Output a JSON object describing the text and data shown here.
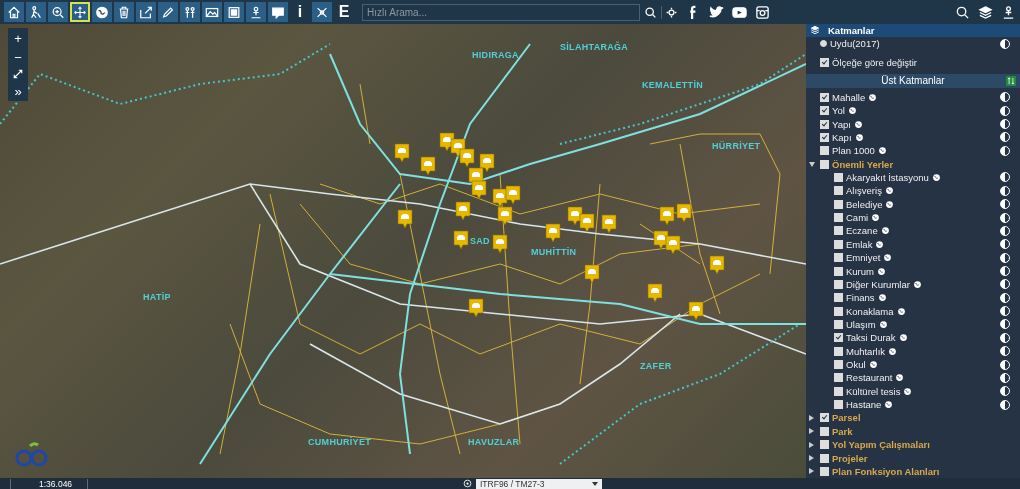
{
  "toolbar": {
    "tools": [
      {
        "kind": "icon",
        "selected": false
      },
      {
        "kind": "icon",
        "selected": false
      },
      {
        "kind": "icon",
        "selected": false
      },
      {
        "kind": "icon",
        "selected": true
      },
      {
        "kind": "icon",
        "selected": false
      },
      {
        "kind": "icon",
        "selected": false
      },
      {
        "kind": "icon",
        "selected": false
      },
      {
        "kind": "icon",
        "selected": false
      },
      {
        "kind": "icon",
        "selected": false
      },
      {
        "kind": "icon",
        "selected": false
      },
      {
        "kind": "icon",
        "selected": false
      },
      {
        "kind": "icon",
        "selected": false
      },
      {
        "kind": "icon",
        "selected": false
      },
      {
        "kind": "text",
        "label": "i",
        "selected": false
      },
      {
        "kind": "icon",
        "selected": false
      },
      {
        "kind": "text",
        "label": "E",
        "selected": false
      }
    ],
    "search": {
      "placeholder": "Hızlı Arama..."
    }
  },
  "map_controls": {
    "zoom_in": "+",
    "zoom_out": "−",
    "more": "»"
  },
  "map_labels": [
    {
      "text": "HIDIRAGA"
    },
    {
      "text": "SİLAHTARAĞA"
    },
    {
      "text": "KEMALETTİN"
    },
    {
      "text": "HÜRRİYET"
    },
    {
      "text": "MUHİTTİN"
    },
    {
      "text": "SAD"
    },
    {
      "text": "HATİP"
    },
    {
      "text": "ZAFER"
    },
    {
      "text": "CUMHURİYET"
    },
    {
      "text": "HAVUZLAR"
    }
  ],
  "layer_panel": {
    "title": "Katmanlar",
    "basemap": {
      "label": "Uydu(2017)",
      "selected": true
    },
    "scale_toggle": {
      "label": "Ölçeğe göre değiştir",
      "checked": true
    },
    "section": "Üst Katmanlar",
    "layers": [
      {
        "kind": "layer",
        "label": "Mahalle",
        "checked": true
      },
      {
        "kind": "layer",
        "label": "Yol",
        "checked": true
      },
      {
        "kind": "layer",
        "label": "Yapı",
        "checked": true
      },
      {
        "kind": "layer",
        "label": "Kapı",
        "checked": true
      },
      {
        "kind": "layer",
        "label": "Plan 1000",
        "checked": false
      },
      {
        "kind": "group",
        "label": "Önemli Yerler",
        "checked": false,
        "expanded": true,
        "children": [
          {
            "label": "Akaryakıt İstasyonu",
            "checked": false
          },
          {
            "label": "Alışveriş",
            "checked": false
          },
          {
            "label": "Belediye",
            "checked": false
          },
          {
            "label": "Cami",
            "checked": false
          },
          {
            "label": "Eczane",
            "checked": false
          },
          {
            "label": "Emlak",
            "checked": false
          },
          {
            "label": "Emniyet",
            "checked": false
          },
          {
            "label": "Kurum",
            "checked": false
          },
          {
            "label": "Diğer Kurumlar",
            "checked": false
          },
          {
            "label": "Finans",
            "checked": false
          },
          {
            "label": "Konaklama",
            "checked": false
          },
          {
            "label": "Ulaşım",
            "checked": false
          },
          {
            "label": "Taksi Durak",
            "checked": true
          },
          {
            "label": "Muhtarlık",
            "checked": false
          },
          {
            "label": "Okul",
            "checked": false
          },
          {
            "label": "Restaurant",
            "checked": false
          },
          {
            "label": "Kültürel tesis",
            "checked": false
          },
          {
            "label": "Hastane",
            "checked": false
          }
        ]
      },
      {
        "kind": "group",
        "label": "Parsel",
        "checked": true,
        "expanded": false
      },
      {
        "kind": "group",
        "label": "Park",
        "checked": false,
        "expanded": false
      },
      {
        "kind": "group",
        "label": "Yol Yapım Çalışmaları",
        "checked": false,
        "expanded": false
      },
      {
        "kind": "group",
        "label": "Projeler",
        "checked": false,
        "expanded": false
      },
      {
        "kind": "group",
        "label": "Plan Fonksiyon Alanları",
        "checked": false,
        "expanded": false
      }
    ]
  },
  "status_bar": {
    "scale": "1:36.046",
    "projection": "ITRF96 / TM27-3"
  }
}
